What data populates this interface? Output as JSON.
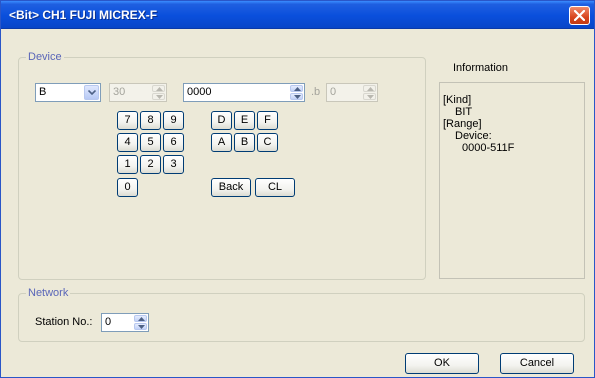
{
  "window": {
    "title": "<Bit> CH1 FUJI MICREX-F"
  },
  "device_group": {
    "legend": "Device"
  },
  "device": {
    "type_value": "B",
    "channel_value": "30",
    "address_value": "0000",
    "bit_separator": ".b",
    "bit_value": "0"
  },
  "keypad": {
    "k7": "7",
    "k8": "8",
    "k9": "9",
    "k4": "4",
    "k5": "5",
    "k6": "6",
    "k1": "1",
    "k2": "2",
    "k3": "3",
    "k0": "0",
    "kD": "D",
    "kE": "E",
    "kF": "F",
    "kA": "A",
    "kB": "B",
    "kC": "C",
    "back": "Back",
    "clear": "CL"
  },
  "information": {
    "label": "Information",
    "kind_heading": "[Kind]",
    "kind_value": "BIT",
    "range_heading": "[Range]",
    "range_label": "Device:",
    "range_value": "0000-511F"
  },
  "network": {
    "legend": "Network",
    "station_label": "Station No.:",
    "station_value": "0"
  },
  "buttons": {
    "ok": "OK",
    "cancel": "Cancel"
  }
}
